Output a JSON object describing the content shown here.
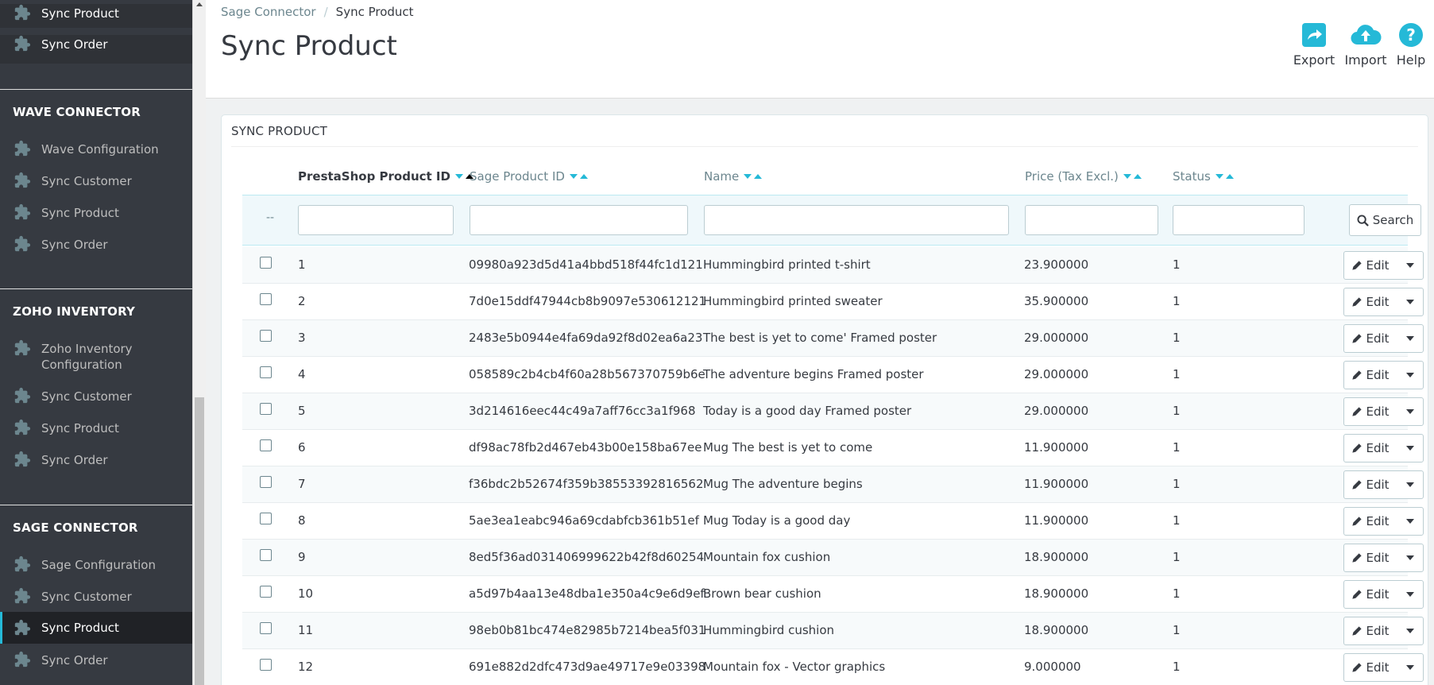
{
  "sidebar": {
    "top_items": [
      {
        "label": "Sync Product",
        "icon": "puzzle-icon"
      },
      {
        "label": "Sync Order",
        "icon": "puzzle-icon"
      }
    ],
    "sections": [
      {
        "title": "WAVE CONNECTOR",
        "items": [
          {
            "label": "Wave Configuration"
          },
          {
            "label": "Sync Customer"
          },
          {
            "label": "Sync Product"
          },
          {
            "label": "Sync Order"
          }
        ]
      },
      {
        "title": "ZOHO INVENTORY",
        "items": [
          {
            "label": "Zoho Inventory",
            "label2": "Configuration"
          },
          {
            "label": "Sync Customer"
          },
          {
            "label": "Sync Product"
          },
          {
            "label": "Sync Order"
          }
        ]
      },
      {
        "title": "SAGE CONNECTOR",
        "items": [
          {
            "label": "Sage Configuration"
          },
          {
            "label": "Sync Customer"
          },
          {
            "label": "Sync Product"
          },
          {
            "label": "Sync Order"
          }
        ]
      }
    ]
  },
  "header": {
    "breadcrumb": {
      "parent": "Sage Connector",
      "separator": "/",
      "current": "Sync Product"
    },
    "title": "Sync Product",
    "toolbar": {
      "export": "Export",
      "import": "Import",
      "help": "Help"
    }
  },
  "panel": {
    "heading": "SYNC PRODUCT",
    "columns": {
      "prestashop_id": "PrestaShop Product ID",
      "sage_id": "Sage Product ID",
      "name": "Name",
      "price": "Price (Tax Excl.)",
      "status": "Status"
    },
    "filter": {
      "dash": "--",
      "search_label": "Search"
    },
    "edit_label": "Edit",
    "rows": [
      {
        "id": "1",
        "sage_id": "09980a923d5d41a4bbd518f44fc1d121",
        "name": "Hummingbird printed t-shirt",
        "price": "23.900000",
        "status": "1"
      },
      {
        "id": "2",
        "sage_id": "7d0e15ddf47944cb8b9097e530612121",
        "name": "Hummingbird printed sweater",
        "price": "35.900000",
        "status": "1"
      },
      {
        "id": "3",
        "sage_id": "2483e5b0944e4fa69da92f8d02ea6a23",
        "name": "The best is yet to come' Framed poster",
        "price": "29.000000",
        "status": "1"
      },
      {
        "id": "4",
        "sage_id": "058589c2b4cb4f60a28b567370759b6e",
        "name": "The adventure begins Framed poster",
        "price": "29.000000",
        "status": "1"
      },
      {
        "id": "5",
        "sage_id": "3d214616eec44c49a7aff76cc3a1f968",
        "name": "Today is a good day Framed poster",
        "price": "29.000000",
        "status": "1"
      },
      {
        "id": "6",
        "sage_id": "df98ac78fb2d467eb43b00e158ba67ee",
        "name": "Mug The best is yet to come",
        "price": "11.900000",
        "status": "1"
      },
      {
        "id": "7",
        "sage_id": "f36bdc2b52674f359b38553392816562",
        "name": "Mug The adventure begins",
        "price": "11.900000",
        "status": "1"
      },
      {
        "id": "8",
        "sage_id": "5ae3ea1eabc946a69cdabfcb361b51ef",
        "name": "Mug Today is a good day",
        "price": "11.900000",
        "status": "1"
      },
      {
        "id": "9",
        "sage_id": "8ed5f36ad031406999622b42f8d60254",
        "name": "Mountain fox cushion",
        "price": "18.900000",
        "status": "1"
      },
      {
        "id": "10",
        "sage_id": "a5d97b4aa13e48dba1e350a4c9e6d9ef",
        "name": "Brown bear cushion",
        "price": "18.900000",
        "status": "1"
      },
      {
        "id": "11",
        "sage_id": "98eb0b81bc474e82985b7214bea5f031",
        "name": "Hummingbird cushion",
        "price": "18.900000",
        "status": "1"
      },
      {
        "id": "12",
        "sage_id": "691e882d2dfc473d9ae49717e9e03398",
        "name": "Mountain fox - Vector graphics",
        "price": "9.000000",
        "status": "1"
      }
    ]
  },
  "colors": {
    "accent": "#25b9d7",
    "sidebar_bg": "#363a41",
    "active_bg": "#202226"
  }
}
